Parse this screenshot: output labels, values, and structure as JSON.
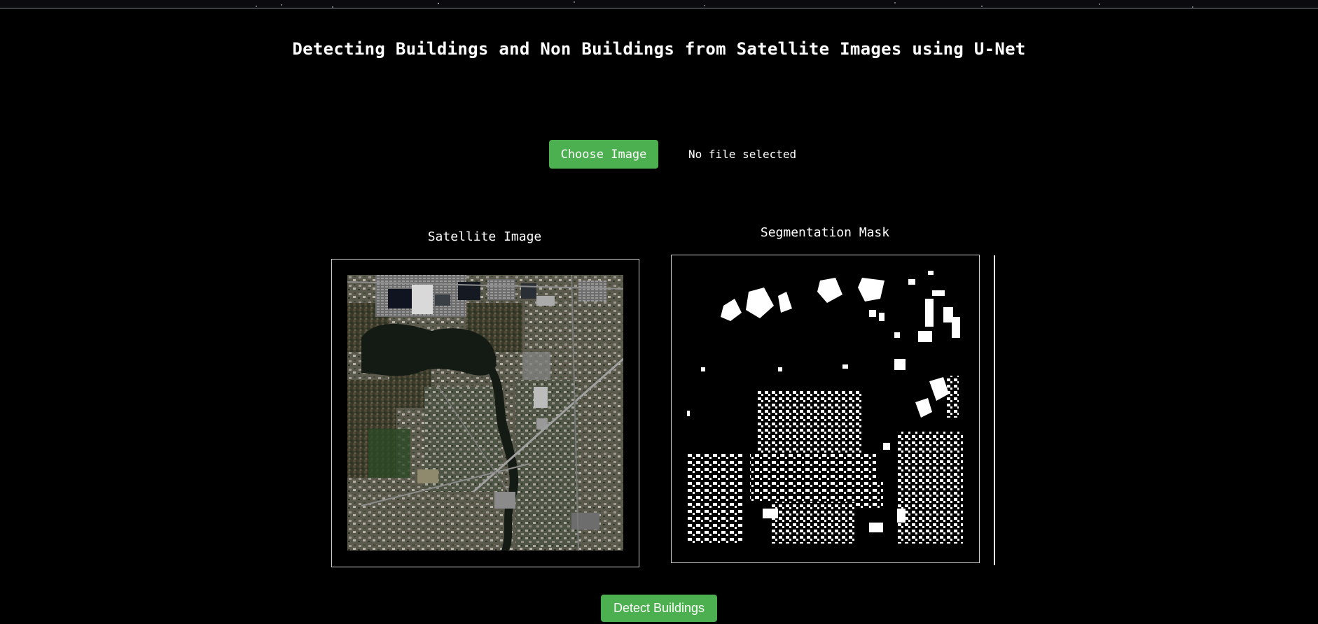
{
  "header": {
    "title": "Detecting Buildings and Non Buildings from Satellite Images using U-Net"
  },
  "upload": {
    "choose_label": "Choose Image",
    "file_status": "No file selected"
  },
  "panels": {
    "satellite_label": "Satellite Image",
    "mask_label": "Segmentation Mask"
  },
  "actions": {
    "detect_label": "Detect Buildings"
  },
  "colors": {
    "background": "#000000",
    "accent_green": "#4caf50",
    "text": "#ffffff",
    "frame_border": "#d0d0d0"
  }
}
